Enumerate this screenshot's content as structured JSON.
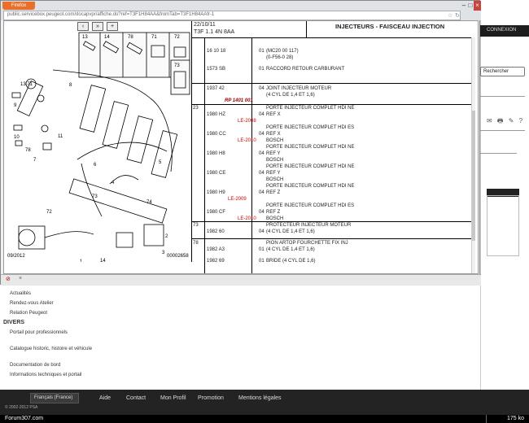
{
  "browser": {
    "app_button": "Firefox",
    "url": "public.servicebox.peugeot.com/docapvpr/affiche.do?ref=T3F1H84AA&fromTab=T3F1H84AAfr-1"
  },
  "diagram": {
    "date_code": "09/2012",
    "code": "00002658",
    "toolbar": [
      "‹",
      "»",
      "+"
    ],
    "callouts": [
      "13",
      "71",
      "8",
      "9",
      "10",
      "78",
      "11",
      "7",
      "72",
      "4",
      "5",
      "6",
      "73",
      "1",
      "14",
      "2",
      "3",
      "74",
      "73"
    ]
  },
  "parts": {
    "date": "22/10/11",
    "model": "T3F 1.1 4N 8AA",
    "title": "INJECTEURS - FAISCEAU INJECTION",
    "rows": [
      {
        "rep": "",
        "ref": "16 10 18",
        "qty": "01",
        "desc": "(MC20 00 117)"
      },
      {
        "rep": "",
        "ref": "",
        "qty": "",
        "desc": "(0-F56-0 28)"
      },
      {
        "rep": "",
        "ref": "1573 SB",
        "qty": "01",
        "desc": "RACCORD RETOUR CARBURANT"
      },
      {
        "rep": "",
        "ref": "1937 42",
        "qty": "04",
        "desc": "JOINT INJECTEUR MOTEUR"
      },
      {
        "rep": "",
        "ref": "",
        "qty": "",
        "desc": "(4 CYL DE 1,4 ET 1,6)"
      },
      {
        "rep": "",
        "ref": "RP 1401 001",
        "qty": "",
        "desc": ""
      },
      {
        "rep": "23",
        "ref": "",
        "qty": "",
        "desc": "PORTE INJECTEUR COMPLET HDI NE"
      },
      {
        "rep": "",
        "ref": "1980 HZ",
        "qty": "04",
        "desc": "REF X"
      },
      {
        "rep": "",
        "ref": "",
        "qty": "",
        "desc": "PORTE INJECTEUR COMPLET HDI ES"
      },
      {
        "rep": "",
        "ref": "1980 CC",
        "qty": "04",
        "desc": "REF X"
      },
      {
        "rep": "",
        "ref": "",
        "qty": "",
        "desc": "BOSCH"
      },
      {
        "rep": "",
        "ref": "",
        "qty": "",
        "desc": "PORTE INJECTEUR COMPLET HDI NE"
      },
      {
        "rep": "",
        "ref": "1980 H8",
        "qty": "04",
        "desc": "REF Y"
      },
      {
        "rep": "",
        "ref": "",
        "qty": "",
        "desc": "BOSCH"
      },
      {
        "rep": "",
        "ref": "",
        "qty": "",
        "desc": "PORTE INJECTEUR COMPLET HDI NE"
      },
      {
        "rep": "",
        "ref": "1980 CE",
        "qty": "04",
        "desc": "REF Y"
      },
      {
        "rep": "",
        "ref": "",
        "qty": "",
        "desc": "BOSCH"
      },
      {
        "rep": "",
        "ref": "",
        "qty": "",
        "desc": "PORTE INJECTEUR COMPLET HDI NE"
      },
      {
        "rep": "",
        "ref": "1980 H9",
        "qty": "04",
        "desc": "REF Z"
      },
      {
        "rep": "",
        "ref": "",
        "qty": "",
        "desc": "PORTE INJECTEUR COMPLET HDI ES"
      },
      {
        "rep": "",
        "ref": "1980 CF",
        "qty": "04",
        "desc": "REF Z"
      },
      {
        "rep": "",
        "ref": "",
        "qty": "",
        "desc": "BOSCH"
      },
      {
        "rep": "73",
        "ref": "",
        "qty": "",
        "desc": "PROTECTEUR INJECTEUR MOTEUR"
      },
      {
        "rep": "",
        "ref": "1982 60",
        "qty": "04",
        "desc": "(4 CYL DE 1,4 ET 1,6)"
      },
      {
        "rep": "78",
        "ref": "",
        "qty": "",
        "desc": "PION ARTOP FOURCHETTE FIX INJ"
      },
      {
        "rep": "",
        "ref": "1982 A3",
        "qty": "01",
        "desc": "(4 CYL DE 1,4 ET 1,6)"
      },
      {
        "rep": "",
        "ref": "1982 69",
        "qty": "01",
        "desc": "BRIDE (4 CYL DE 1,6)"
      }
    ],
    "red_codes": [
      "LE-2008",
      "LE-2010",
      "LE-2009",
      "LE-2010"
    ]
  },
  "popup_status": {
    "close_label": "×"
  },
  "background": {
    "dark_tab": "CONNEXION",
    "pill": "Rechercher",
    "icons": "✉ 🖶 ✎ ?"
  },
  "left_links": {
    "items_top": [
      "Actualités",
      "Rendez-vous Atelier",
      "Relation Peugeot"
    ],
    "section": "DIVERS",
    "items_bottom": [
      "Portail pour professionnels",
      "Catalogue historic, histoire et véhicule",
      "Documentation de bord",
      "Informations techniques et portail"
    ]
  },
  "footer": {
    "language": "Français (France)",
    "links": [
      "Aide",
      "Contact",
      "Mon Profil",
      "Promotion",
      "Mentions légales"
    ],
    "copyright": "© 2002-2012 PSA"
  },
  "statusbar": {
    "left": "Forum307.com",
    "right": "175 ko"
  }
}
